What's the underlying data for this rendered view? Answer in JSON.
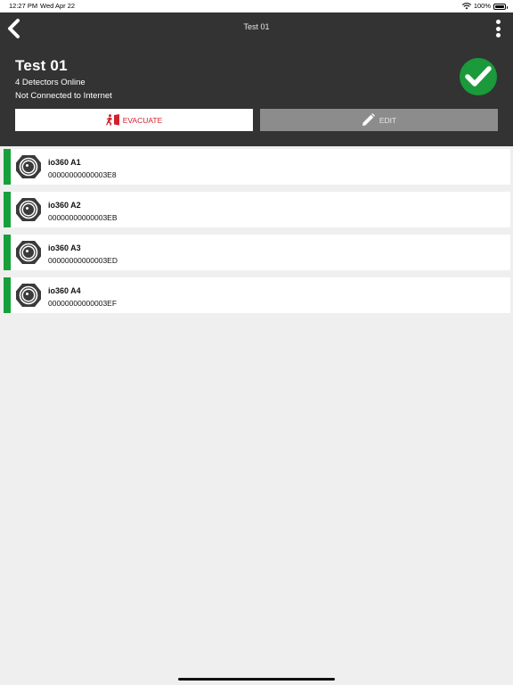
{
  "status_bar": {
    "time": "12:27 PM",
    "date": "Wed Apr 22",
    "battery": "100%"
  },
  "nav": {
    "title": "Test 01"
  },
  "site": {
    "name": "Test 01",
    "detectors_online": "4 Detectors Online",
    "connection_status": "Not Connected to Internet"
  },
  "actions": {
    "evacuate_label": "EVACUATE",
    "edit_label": "EDIT"
  },
  "devices": [
    {
      "name": "io360 A1",
      "serial": "00000000000003E8"
    },
    {
      "name": "io360 A2",
      "serial": "00000000000003EB"
    },
    {
      "name": "io360 A3",
      "serial": "00000000000003ED"
    },
    {
      "name": "io360 A4",
      "serial": "00000000000003EF"
    }
  ],
  "colors": {
    "header": "#333333",
    "online": "#16a03a",
    "evacuate": "#d1202f",
    "edit_bg": "#8c8c8c",
    "background": "#efefef"
  }
}
